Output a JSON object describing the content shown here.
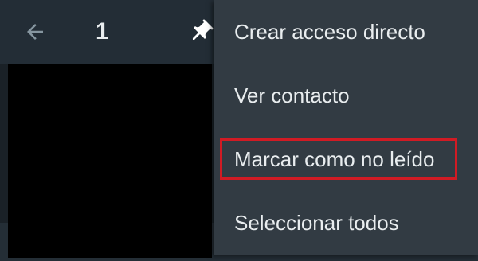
{
  "app_bar": {
    "back_icon": "arrow-left-icon",
    "selected_count": "1",
    "pin_icon": "pin-icon"
  },
  "menu": {
    "items": [
      {
        "label": "Crear acceso directo"
      },
      {
        "label": "Ver contacto"
      },
      {
        "label": "Marcar como no leído",
        "highlighted": true
      },
      {
        "label": "Seleccionar todos"
      }
    ]
  },
  "colors": {
    "app_bar": "#232d36",
    "menu_bg": "#323b43",
    "text": "#e9edef",
    "highlight": "#d11b24"
  }
}
